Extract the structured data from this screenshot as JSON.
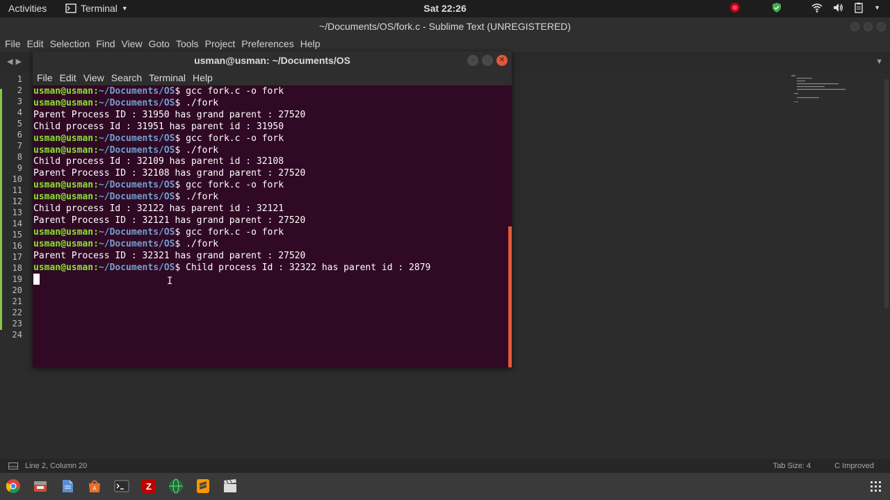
{
  "topbar": {
    "activities": "Activities",
    "app_name": "Terminal",
    "clock": "Sat 22:26"
  },
  "sublime": {
    "title": "~/Documents/OS/fork.c - Sublime Text (UNREGISTERED)",
    "menu": [
      "File",
      "Edit",
      "Selection",
      "Find",
      "View",
      "Goto",
      "Tools",
      "Project",
      "Preferences",
      "Help"
    ],
    "line_numbers": [
      "1",
      "2",
      "3",
      "4",
      "5",
      "6",
      "7",
      "8",
      "9",
      "10",
      "11",
      "12",
      "13",
      "14",
      "15",
      "16",
      "17",
      "18",
      "19",
      "20",
      "21",
      "22",
      "23",
      "24"
    ],
    "status_left": "Line 2, Column 20",
    "status_tab": "Tab Size: 4",
    "status_syntax": "C Improved"
  },
  "terminal": {
    "title": "usman@usman: ~/Documents/OS",
    "menu": [
      "File",
      "Edit",
      "View",
      "Search",
      "Terminal",
      "Help"
    ],
    "prompt_user": "usman@usman",
    "prompt_path": "~/Documents/OS",
    "lines": [
      {
        "type": "prompt",
        "cmd": " gcc fork.c -o fork"
      },
      {
        "type": "prompt",
        "cmd": " ./fork"
      },
      {
        "type": "out",
        "text": "Parent Process ID : 31950 has grand parent : 27520"
      },
      {
        "type": "out",
        "text": "Child process Id : 31951 has parent id : 31950"
      },
      {
        "type": "prompt",
        "cmd": " gcc fork.c -o fork"
      },
      {
        "type": "prompt",
        "cmd": " ./fork"
      },
      {
        "type": "out",
        "text": "Child process Id : 32109 has parent id : 32108"
      },
      {
        "type": "out",
        "text": "Parent Process ID : 32108 has grand parent : 27520"
      },
      {
        "type": "prompt",
        "cmd": " gcc fork.c -o fork"
      },
      {
        "type": "prompt",
        "cmd": " ./fork"
      },
      {
        "type": "out",
        "text": "Child process Id : 32122 has parent id : 32121"
      },
      {
        "type": "out",
        "text": "Parent Process ID : 32121 has grand parent : 27520"
      },
      {
        "type": "prompt",
        "cmd": " gcc fork.c -o fork"
      },
      {
        "type": "prompt",
        "cmd": " ./fork"
      },
      {
        "type": "out",
        "text": "Parent Process ID : 32321 has grand parent : 27520"
      },
      {
        "type": "prompt",
        "cmd": " Child process Id : 32322 has parent id : 2879"
      }
    ]
  },
  "dock": {
    "apps": [
      "chrome-icon",
      "files-icon",
      "text-editor-icon",
      "software-center-icon",
      "terminal-icon",
      "filezilla-icon",
      "globe-icon",
      "sublime-icon",
      "video-editor-icon"
    ]
  },
  "colors": {
    "terminal_bg": "#300a24",
    "prompt_user": "#8ae234",
    "prompt_path": "#729fcf",
    "close_button": "#e2573a"
  }
}
